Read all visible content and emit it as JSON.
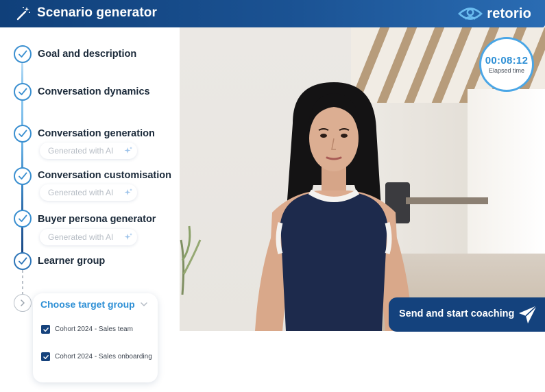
{
  "header": {
    "title": "Scenario generator",
    "brand_name": "retorio",
    "wand_icon": "magic-wand-icon",
    "brand_icon": "eye-logo-icon"
  },
  "steps": [
    {
      "label": "Goal and description",
      "status": "complete"
    },
    {
      "label": "Conversation dynamics",
      "status": "complete"
    },
    {
      "label": "Conversation generation",
      "status": "complete",
      "chip": "Generated with AI"
    },
    {
      "label": "Conversation customisation",
      "status": "complete",
      "chip": "Generated with AI"
    },
    {
      "label": "Buyer persona generator",
      "status": "complete",
      "chip": "Generated with AI"
    },
    {
      "label": "Learner group",
      "status": "complete"
    }
  ],
  "dropdown": {
    "title": "Choose target group",
    "options": [
      {
        "label": "Cohort 2024 - Sales team",
        "checked": true
      },
      {
        "label": "Cohort 2024 - Sales onboarding",
        "checked": true
      }
    ]
  },
  "timer": {
    "value": "00:08:12",
    "label": "Elapsed time"
  },
  "send_button": {
    "label": "Send and start coaching",
    "icon": "paper-plane-icon"
  },
  "colors": {
    "header_start": "#10407a",
    "header_end": "#2a6cb3",
    "accent": "#2d8fd5",
    "navy": "#14427d"
  }
}
